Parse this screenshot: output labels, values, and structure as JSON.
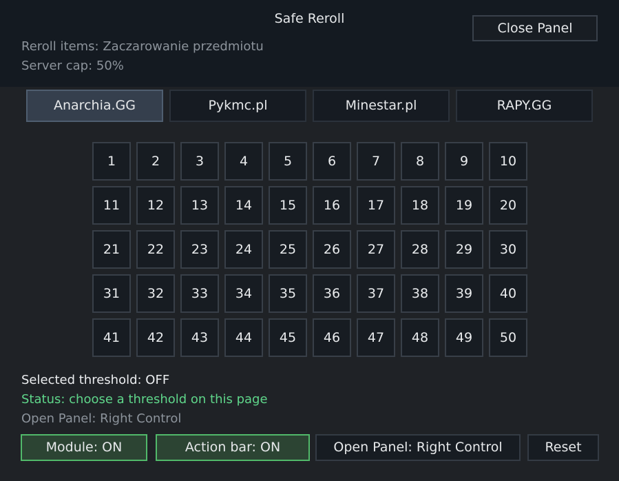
{
  "header": {
    "title": "Safe Reroll",
    "reroll_items": "Reroll items: Zaczarowanie przedmiotu",
    "server_cap": "Server cap: 50%",
    "close_label": "Close Panel"
  },
  "tabs": [
    {
      "label": "Anarchia.GG",
      "active": true
    },
    {
      "label": "Pykmc.pl",
      "active": false
    },
    {
      "label": "Minestar.pl",
      "active": false
    },
    {
      "label": "RAPY.GG",
      "active": false
    }
  ],
  "thresholds": [
    "1",
    "2",
    "3",
    "4",
    "5",
    "6",
    "7",
    "8",
    "9",
    "10",
    "11",
    "12",
    "13",
    "14",
    "15",
    "16",
    "17",
    "18",
    "19",
    "20",
    "21",
    "22",
    "23",
    "24",
    "25",
    "26",
    "27",
    "28",
    "29",
    "30",
    "31",
    "32",
    "33",
    "34",
    "35",
    "36",
    "37",
    "38",
    "39",
    "40",
    "41",
    "42",
    "43",
    "44",
    "45",
    "46",
    "47",
    "48",
    "49",
    "50"
  ],
  "footer": {
    "selected_threshold": "Selected threshold: OFF",
    "status": "Status: choose a threshold on this page",
    "open_panel_hint": "Open Panel: Right Control"
  },
  "buttons": {
    "module": "Module: ON",
    "action_bar": "Action bar: ON",
    "open_panel": "Open Panel: Right Control",
    "reset": "Reset"
  },
  "colors": {
    "status_green": "#5fd68a",
    "on_border": "#51b96a",
    "active_tab": "#353f4d"
  }
}
